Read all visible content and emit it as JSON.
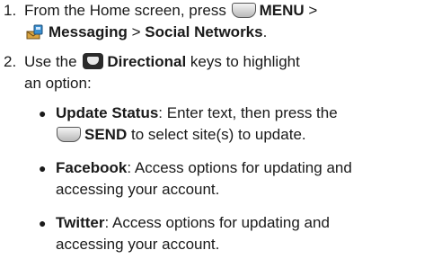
{
  "steps": [
    {
      "number": "1.",
      "line1_prefix": "From the Home screen, press",
      "menu_label": "MENU",
      "sep1": ">",
      "messaging_label": "Messaging",
      "sep2": ">",
      "social_label": "Social Networks",
      "end": "."
    },
    {
      "number": "2.",
      "prefix": "Use the",
      "directional_label": "Directional",
      "line1_suffix": "keys to highlight",
      "line2": "an option:"
    }
  ],
  "bullets": [
    {
      "dot": "●",
      "title": "Update Status",
      "line1_rest": ": Enter text, then press the",
      "send_label": "SEND",
      "line2_rest": "to select site(s) to update."
    },
    {
      "dot": "●",
      "title": "Facebook",
      "line1_rest": ": Access options for updating and",
      "line2": "accessing your account."
    },
    {
      "dot": "●",
      "title": "Twitter",
      "line1_rest": ": Access options for updating and",
      "line2": "accessing your account."
    }
  ],
  "icons": {
    "menu_key": "softkey-icon",
    "messaging": "messaging-envelope-icon",
    "directional": "directional-key-icon",
    "send_key": "softkey-icon"
  }
}
